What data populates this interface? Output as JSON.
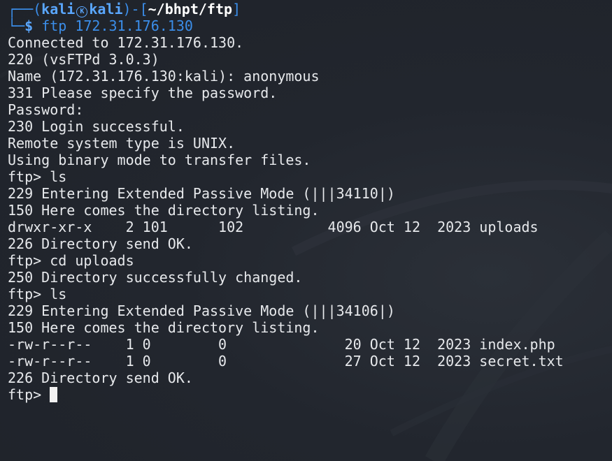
{
  "prompt": {
    "box_top_left": "┌──(",
    "user": "kali",
    "host_icon": "kali-dragon-icon",
    "host": "kali",
    "bracket_open": ")-[",
    "path": "~/bhpt/ftp",
    "bracket_close": "]",
    "box_bottom_left": "└─",
    "dollar": "$ ",
    "command": "ftp 172.31.176.130"
  },
  "lines": [
    "Connected to 172.31.176.130.",
    "220 (vsFTPd 3.0.3)",
    "Name (172.31.176.130:kali): anonymous",
    "331 Please specify the password.",
    "Password:",
    "230 Login successful.",
    "Remote system type is UNIX.",
    "Using binary mode to transfer files.",
    "ftp> ls",
    "229 Entering Extended Passive Mode (|||34110|)",
    "150 Here comes the directory listing.",
    "drwxr-xr-x    2 101      102          4096 Oct 12  2023 uploads",
    "226 Directory send OK.",
    "ftp> cd uploads",
    "250 Directory successfully changed.",
    "ftp> ls",
    "229 Entering Extended Passive Mode (|||34106|)",
    "150 Here comes the directory listing.",
    "-rw-r--r--    1 0        0              20 Oct 12  2023 index.php",
    "-rw-r--r--    1 0        0              27 Oct 12  2023 secret.txt",
    "226 Directory send OK."
  ],
  "current_prompt": "ftp> ",
  "colors": {
    "background": "#21252d",
    "prompt_blue": "#3b8eea",
    "prompt_bold_blue": "#5aa7ff",
    "text": "#e7e9ec"
  }
}
